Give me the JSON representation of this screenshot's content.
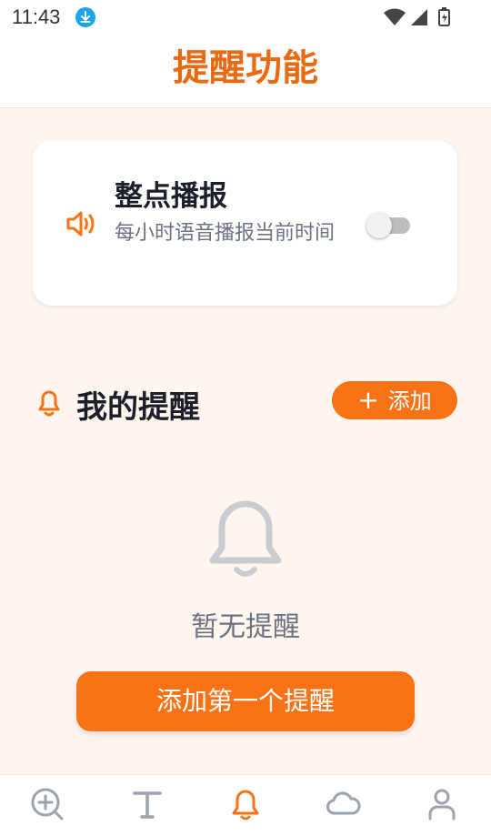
{
  "status_bar": {
    "time": "11:43"
  },
  "header": {
    "title": "提醒功能"
  },
  "hourly_card": {
    "title": "整点播报",
    "description": "每小时语音播报当前时间",
    "toggle_on": false
  },
  "reminders": {
    "title": "我的提醒",
    "add_label": "添加",
    "empty_text": "暂无提醒",
    "add_first_label": "添加第一个提醒"
  },
  "nav": {
    "items": [
      {
        "name": "search",
        "active": false
      },
      {
        "name": "text",
        "active": false
      },
      {
        "name": "bell",
        "active": true
      },
      {
        "name": "cloud",
        "active": false
      },
      {
        "name": "user",
        "active": false
      }
    ]
  },
  "colors": {
    "accent": "#f97316",
    "title": "#ea6a12",
    "inactive": "#9ca3af"
  }
}
